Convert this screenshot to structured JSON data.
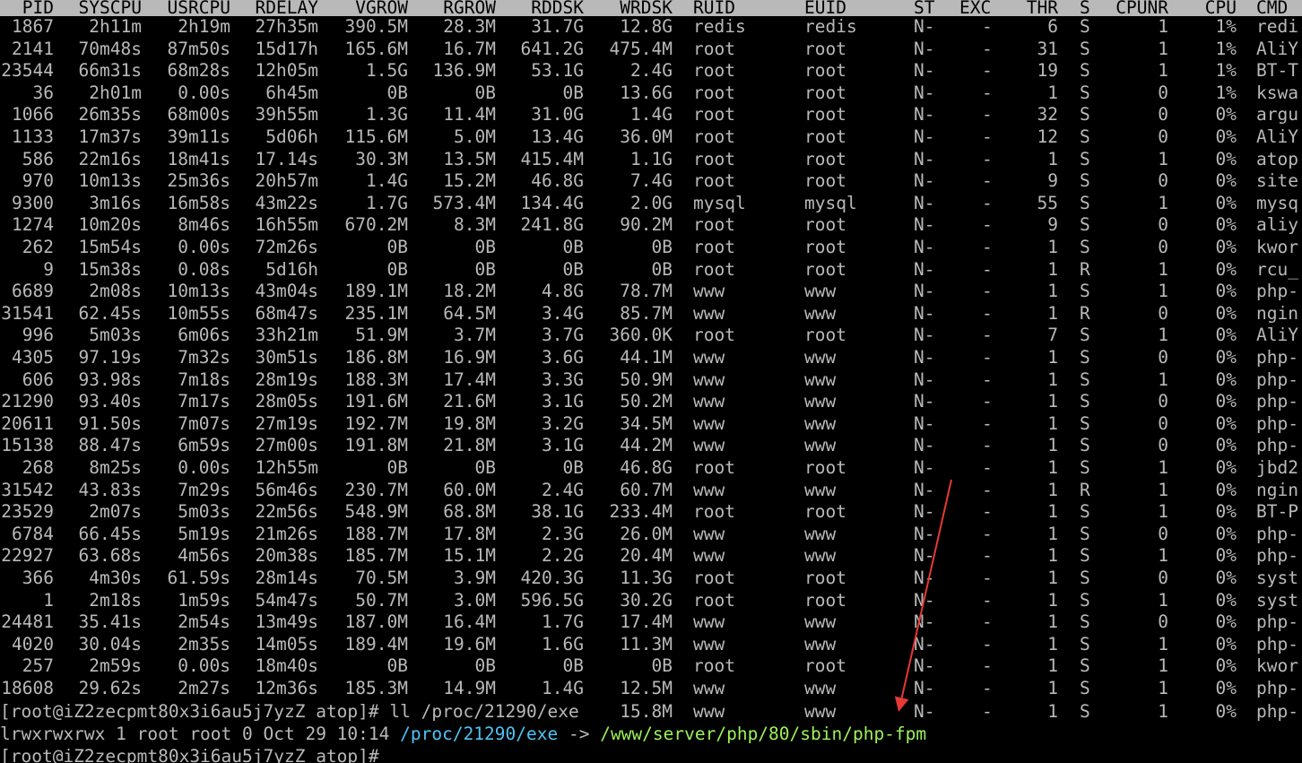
{
  "colors": {
    "background": "#000000",
    "text": "#b9b9b9",
    "header_bg": "#b9b9b9",
    "header_text": "#000000",
    "link_path": "#4fc3f7",
    "target_path": "#9cf25a",
    "annotation_arrow": "#e53935"
  },
  "table": {
    "columns": [
      "PID",
      "SYSCPU",
      "USRCPU",
      "RDELAY",
      "VGROW",
      "RGROW",
      "RDDSK",
      "WRDSK",
      "RUID",
      "EUID",
      "ST",
      "EXC",
      "THR",
      "S",
      "CPUNR",
      "CPU",
      "CMD"
    ],
    "rows": [
      [
        "1867",
        "2h11m",
        "2h19m",
        "27h35m",
        "390.5M",
        "28.3M",
        "31.7G",
        "12.8G",
        "redis",
        "redis",
        "N-",
        "-",
        "6",
        "S",
        "1",
        "1%",
        "redi"
      ],
      [
        "2141",
        "70m48s",
        "87m50s",
        "15d17h",
        "165.6M",
        "16.7M",
        "641.2G",
        "475.4M",
        "root",
        "root",
        "N-",
        "-",
        "31",
        "S",
        "1",
        "1%",
        "AliY"
      ],
      [
        "23544",
        "66m31s",
        "68m28s",
        "12h05m",
        "1.5G",
        "136.9M",
        "53.1G",
        "2.4G",
        "root",
        "root",
        "N-",
        "-",
        "19",
        "S",
        "1",
        "1%",
        "BT-T"
      ],
      [
        "36",
        "2h01m",
        "0.00s",
        "6h45m",
        "0B",
        "0B",
        "0B",
        "13.6G",
        "root",
        "root",
        "N-",
        "-",
        "1",
        "S",
        "0",
        "1%",
        "kswa"
      ],
      [
        "1066",
        "26m35s",
        "68m00s",
        "39h55m",
        "1.3G",
        "11.4M",
        "31.0G",
        "1.4G",
        "root",
        "root",
        "N-",
        "-",
        "32",
        "S",
        "0",
        "0%",
        "argu"
      ],
      [
        "1133",
        "17m37s",
        "39m11s",
        "5d06h",
        "115.6M",
        "5.0M",
        "13.4G",
        "36.0M",
        "root",
        "root",
        "N-",
        "-",
        "12",
        "S",
        "0",
        "0%",
        "AliY"
      ],
      [
        "586",
        "22m16s",
        "18m41s",
        "17.14s",
        "30.3M",
        "13.5M",
        "415.4M",
        "1.1G",
        "root",
        "root",
        "N-",
        "-",
        "1",
        "S",
        "1",
        "0%",
        "atop"
      ],
      [
        "970",
        "10m13s",
        "25m36s",
        "20h57m",
        "1.4G",
        "15.2M",
        "46.8G",
        "7.4G",
        "root",
        "root",
        "N-",
        "-",
        "9",
        "S",
        "0",
        "0%",
        "site"
      ],
      [
        "9300",
        "3m16s",
        "16m58s",
        "43m22s",
        "1.7G",
        "573.4M",
        "134.4G",
        "2.0G",
        "mysql",
        "mysql",
        "N-",
        "-",
        "55",
        "S",
        "1",
        "0%",
        "mysq"
      ],
      [
        "1274",
        "10m20s",
        "8m46s",
        "16h55m",
        "670.2M",
        "8.3M",
        "241.8G",
        "90.2M",
        "root",
        "root",
        "N-",
        "-",
        "9",
        "S",
        "0",
        "0%",
        "aliy"
      ],
      [
        "262",
        "15m54s",
        "0.00s",
        "72m26s",
        "0B",
        "0B",
        "0B",
        "0B",
        "root",
        "root",
        "N-",
        "-",
        "1",
        "S",
        "0",
        "0%",
        "kwor"
      ],
      [
        "9",
        "15m38s",
        "0.08s",
        "5d16h",
        "0B",
        "0B",
        "0B",
        "0B",
        "root",
        "root",
        "N-",
        "-",
        "1",
        "R",
        "1",
        "0%",
        "rcu_"
      ],
      [
        "6689",
        "2m08s",
        "10m13s",
        "43m04s",
        "189.1M",
        "18.2M",
        "4.8G",
        "78.7M",
        "www",
        "www",
        "N-",
        "-",
        "1",
        "S",
        "1",
        "0%",
        "php-"
      ],
      [
        "31541",
        "62.45s",
        "10m55s",
        "68m47s",
        "235.1M",
        "64.5M",
        "3.4G",
        "85.7M",
        "www",
        "www",
        "N-",
        "-",
        "1",
        "R",
        "0",
        "0%",
        "ngin"
      ],
      [
        "996",
        "5m03s",
        "6m06s",
        "33h21m",
        "51.9M",
        "3.7M",
        "3.7G",
        "360.0K",
        "root",
        "root",
        "N-",
        "-",
        "7",
        "S",
        "1",
        "0%",
        "AliY"
      ],
      [
        "4305",
        "97.19s",
        "7m32s",
        "30m51s",
        "186.8M",
        "16.9M",
        "3.6G",
        "44.1M",
        "www",
        "www",
        "N-",
        "-",
        "1",
        "S",
        "0",
        "0%",
        "php-"
      ],
      [
        "606",
        "93.98s",
        "7m18s",
        "28m19s",
        "188.3M",
        "17.4M",
        "3.3G",
        "50.9M",
        "www",
        "www",
        "N-",
        "-",
        "1",
        "S",
        "1",
        "0%",
        "php-"
      ],
      [
        "21290",
        "93.40s",
        "7m17s",
        "28m05s",
        "191.6M",
        "21.6M",
        "3.1G",
        "50.2M",
        "www",
        "www",
        "N-",
        "-",
        "1",
        "S",
        "0",
        "0%",
        "php-"
      ],
      [
        "20611",
        "91.50s",
        "7m07s",
        "27m19s",
        "192.7M",
        "19.8M",
        "3.2G",
        "34.5M",
        "www",
        "www",
        "N-",
        "-",
        "1",
        "S",
        "0",
        "0%",
        "php-"
      ],
      [
        "15138",
        "88.47s",
        "6m59s",
        "27m00s",
        "191.8M",
        "21.8M",
        "3.1G",
        "44.2M",
        "www",
        "www",
        "N-",
        "-",
        "1",
        "S",
        "0",
        "0%",
        "php-"
      ],
      [
        "268",
        "8m25s",
        "0.00s",
        "12h55m",
        "0B",
        "0B",
        "0B",
        "46.8G",
        "root",
        "root",
        "N-",
        "-",
        "1",
        "S",
        "1",
        "0%",
        "jbd2"
      ],
      [
        "31542",
        "43.83s",
        "7m29s",
        "56m46s",
        "230.7M",
        "60.0M",
        "2.4G",
        "60.7M",
        "www",
        "www",
        "N-",
        "-",
        "1",
        "R",
        "1",
        "0%",
        "ngin"
      ],
      [
        "23529",
        "2m07s",
        "5m03s",
        "22m56s",
        "548.9M",
        "68.8M",
        "38.1G",
        "233.4M",
        "root",
        "root",
        "N-",
        "-",
        "1",
        "S",
        "1",
        "0%",
        "BT-P"
      ],
      [
        "6784",
        "66.45s",
        "5m19s",
        "21m26s",
        "188.7M",
        "17.8M",
        "2.3G",
        "26.0M",
        "www",
        "www",
        "N-",
        "-",
        "1",
        "S",
        "0",
        "0%",
        "php-"
      ],
      [
        "22927",
        "63.68s",
        "4m56s",
        "20m38s",
        "185.7M",
        "15.1M",
        "2.2G",
        "20.4M",
        "www",
        "www",
        "N-",
        "-",
        "1",
        "S",
        "1",
        "0%",
        "php-"
      ],
      [
        "366",
        "4m30s",
        "61.59s",
        "28m14s",
        "70.5M",
        "3.9M",
        "420.3G",
        "11.3G",
        "root",
        "root",
        "N-",
        "-",
        "1",
        "S",
        "0",
        "0%",
        "syst"
      ],
      [
        "1",
        "2m18s",
        "1m59s",
        "54m47s",
        "50.7M",
        "3.0M",
        "596.5G",
        "30.2G",
        "root",
        "root",
        "N-",
        "-",
        "1",
        "S",
        "1",
        "0%",
        "syst"
      ],
      [
        "24481",
        "35.41s",
        "2m54s",
        "13m49s",
        "187.0M",
        "16.4M",
        "1.7G",
        "17.4M",
        "www",
        "www",
        "N-",
        "-",
        "1",
        "S",
        "0",
        "0%",
        "php-"
      ],
      [
        "4020",
        "30.04s",
        "2m35s",
        "14m05s",
        "189.4M",
        "19.6M",
        "1.6G",
        "11.3M",
        "www",
        "www",
        "N-",
        "-",
        "1",
        "S",
        "1",
        "0%",
        "php-"
      ],
      [
        "257",
        "2m59s",
        "0.00s",
        "18m40s",
        "0B",
        "0B",
        "0B",
        "0B",
        "root",
        "root",
        "N-",
        "-",
        "1",
        "S",
        "1",
        "0%",
        "kwor"
      ],
      [
        "18608",
        "29.62s",
        "2m27s",
        "12m36s",
        "185.3M",
        "14.9M",
        "1.4G",
        "12.5M",
        "www",
        "www",
        "N-",
        "-",
        "1",
        "S",
        "1",
        "0%",
        "php-"
      ]
    ],
    "overwritten_row_tail": [
      "15.8M",
      "www",
      "www",
      "N-",
      "-",
      "1",
      "S",
      "1",
      "0%",
      "php-"
    ]
  },
  "terminal": {
    "prompt_command": "[root@iZ2zecpmt80x3i6au5j7yzZ atop]# ll /proc/21290/exe",
    "ls_prefix": "lrwxrwxrwx 1 root root 0 Oct 29 10:14 ",
    "link_path": "/proc/21290/exe",
    "link_arrow": " -> ",
    "link_target": "/www/server/php/80/sbin/php-fpm",
    "next_prompt": "[root@iZ2zecpmt80x3i6au5j7yzZ atop]#"
  }
}
